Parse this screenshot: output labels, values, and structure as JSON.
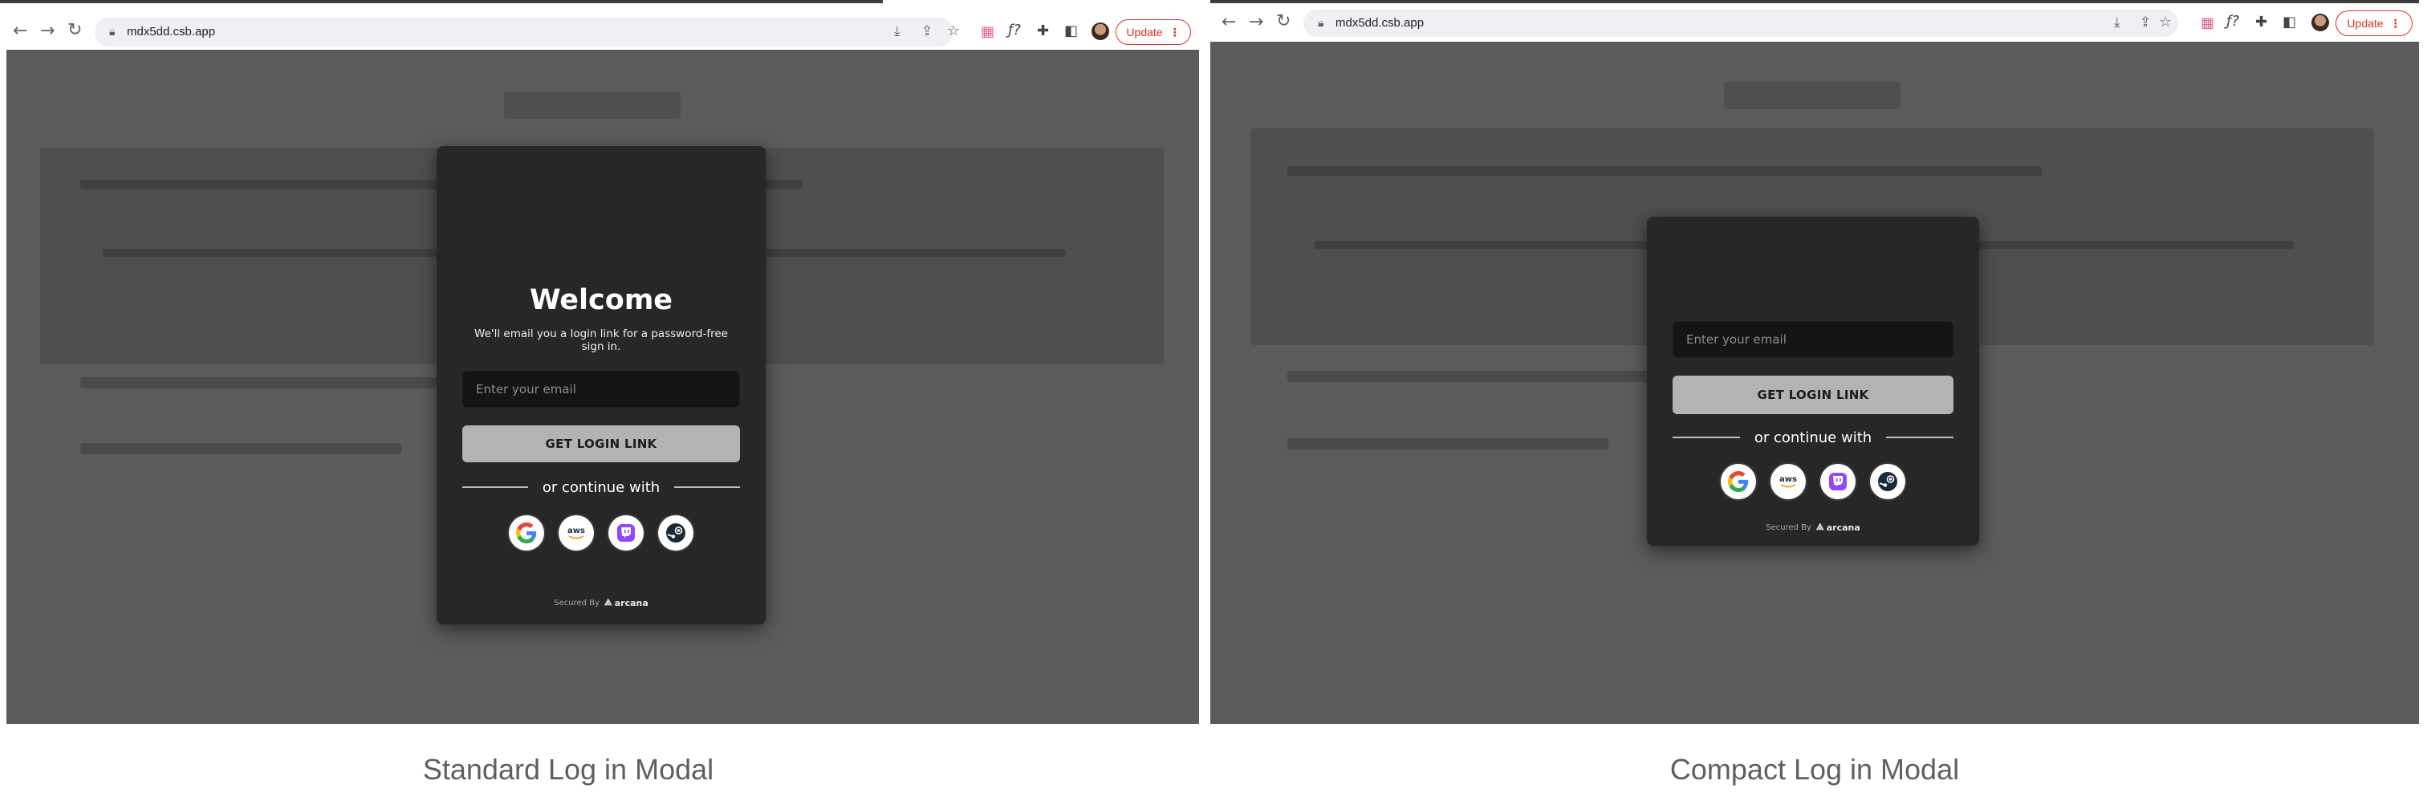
{
  "browser": {
    "url": "mdx5dd.csb.app",
    "update_label": "Update",
    "menu_icon": "⋮"
  },
  "standard": {
    "caption": "Standard Log in Modal",
    "welcome": "Welcome",
    "subtitle": "We'll email you a login link for a password-free sign in.",
    "email_placeholder": "Enter your email",
    "button_label": "GET LOGIN LINK",
    "divider_text": "or continue with",
    "secured_by": "Secured By",
    "brand": "arcana"
  },
  "compact": {
    "caption": "Compact Log in Modal",
    "email_placeholder": "Enter your email",
    "button_label": "GET LOGIN LINK",
    "divider_text": "or continue with",
    "secured_by": "Secured By",
    "brand": "arcana"
  },
  "social_providers": [
    "google-icon",
    "aws-icon",
    "twitch-icon",
    "steam-icon"
  ],
  "colors": {
    "overlay": "#5b5b5b",
    "modal_bg": "#272727",
    "button_bg": "#b3b3b3",
    "update_red": "#d93025"
  }
}
